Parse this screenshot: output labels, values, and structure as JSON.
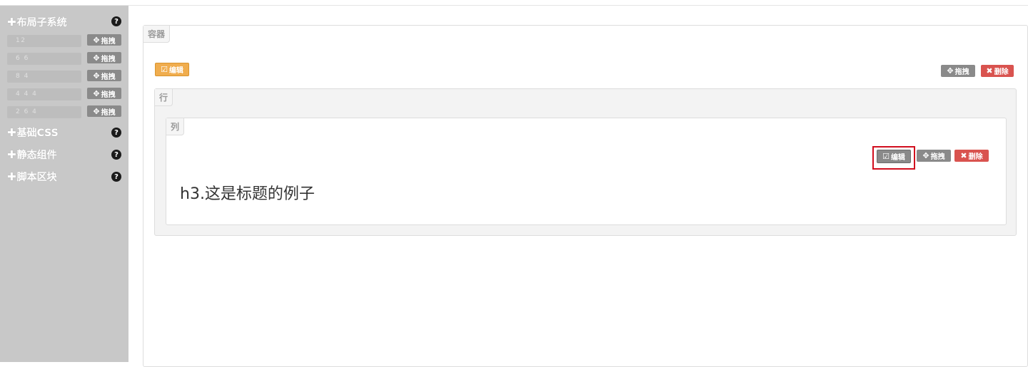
{
  "sidebar": {
    "sections": [
      {
        "label": "布局子系统",
        "help": "?"
      },
      {
        "label": "基础CSS",
        "help": "?"
      },
      {
        "label": "静态组件",
        "help": "?"
      },
      {
        "label": "脚本区块",
        "help": "?"
      }
    ],
    "layouts": [
      {
        "preview": "12",
        "drag_label": "拖拽"
      },
      {
        "preview": "6 6",
        "drag_label": "拖拽"
      },
      {
        "preview": "8 4",
        "drag_label": "拖拽"
      },
      {
        "preview": "4 4 4",
        "drag_label": "拖拽"
      },
      {
        "preview": "2 6 4",
        "drag_label": "拖拽"
      }
    ]
  },
  "container": {
    "tag": "容器",
    "edit_label": "编辑",
    "drag_label": "拖拽",
    "delete_label": "删除"
  },
  "row": {
    "tag": "行"
  },
  "column": {
    "tag": "列",
    "edit_label": "编辑",
    "drag_label": "拖拽",
    "delete_label": "删除",
    "heading_text": "h3.这是标题的例子"
  },
  "colors": {
    "sidebar_bg": "#c8c8c8",
    "edit_orange": "#f0ad4e",
    "delete_red": "#d9534f",
    "drag_gray": "#8a8a8a",
    "highlight_red": "#d10e1e"
  },
  "icons": {
    "plus": "plus-icon",
    "help": "question-circle-icon",
    "move": "move-icon",
    "edit": "edit-icon",
    "remove": "remove-icon"
  }
}
